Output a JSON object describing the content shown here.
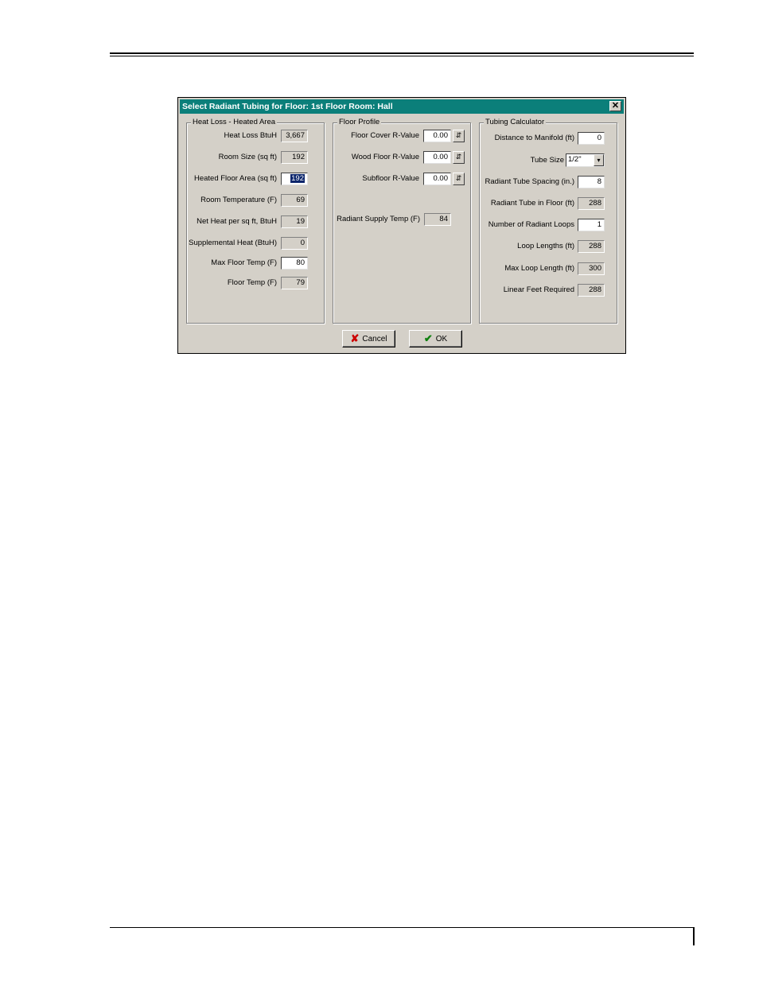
{
  "dialog": {
    "title": "Select Radiant Tubing for Floor: 1st Floor  Room: Hall",
    "close_glyph": "✕"
  },
  "heat_loss": {
    "group_title": "Heat Loss - Heated Area",
    "fields": [
      {
        "label": "Heat Loss BtuH",
        "value": "3,667"
      },
      {
        "label": "Room Size (sq ft)",
        "value": "192"
      },
      {
        "label": "Heated Floor Area (sq ft)",
        "value": "192"
      },
      {
        "label": "Room Temperature (F)",
        "value": "69"
      },
      {
        "label": "Net Heat per sq ft, BtuH",
        "value": "19"
      },
      {
        "label": "Supplemental Heat (BtuH)",
        "value": "0"
      },
      {
        "label": "Max Floor Temp (F)",
        "value": "80"
      },
      {
        "label": "Floor Temp (F)",
        "value": "79"
      }
    ]
  },
  "floor_profile": {
    "group_title": "Floor Profile",
    "fields": [
      {
        "label": "Floor Cover R-Value",
        "value": "0.00"
      },
      {
        "label": "Wood Floor R-Value",
        "value": "0.00"
      },
      {
        "label": "Subfloor R-Value",
        "value": "0.00"
      },
      {
        "label": "Radiant Supply Temp (F)",
        "value": "84"
      }
    ],
    "spin_glyph": "⇵"
  },
  "tubing": {
    "group_title": "Tubing Calculator",
    "fields": [
      {
        "label": "Distance to Manifold (ft)",
        "value": "0"
      },
      {
        "label": "Tube Size",
        "value": "1/2\""
      },
      {
        "label": "Radiant Tube Spacing (in.)",
        "value": "8"
      },
      {
        "label": "Radiant Tube in Floor (ft)",
        "value": "288"
      },
      {
        "label": "Number of Radiant Loops",
        "value": "1"
      },
      {
        "label": "Loop Lengths (ft)",
        "value": "288"
      },
      {
        "label": "Max Loop Length (ft)",
        "value": "300"
      },
      {
        "label": "Linear Feet Required",
        "value": "288"
      }
    ],
    "combo_glyph": "▾"
  },
  "buttons": {
    "cancel_icon": "✘",
    "cancel_label": "Cancel",
    "ok_icon": "✔",
    "ok_label": "OK",
    "cancel_icon_color": "#cc0000",
    "ok_icon_color": "#108010"
  }
}
